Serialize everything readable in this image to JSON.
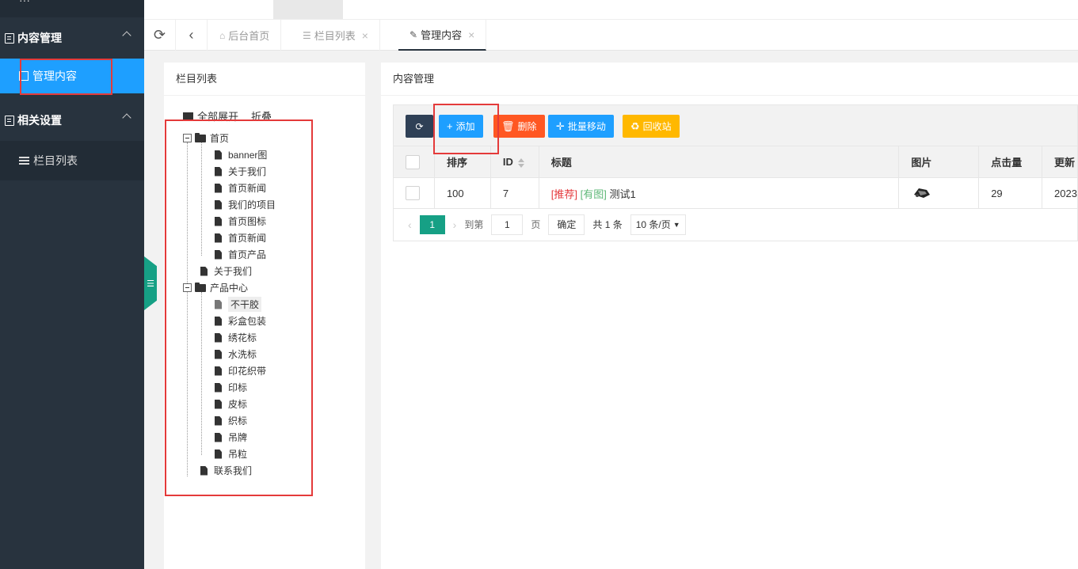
{
  "sidebar": {
    "logo_text": "···",
    "groups": [
      {
        "label": "内容管理",
        "items": [
          {
            "label": "管理内容",
            "active": true
          }
        ]
      },
      {
        "label": "相关设置",
        "items": [
          {
            "label": "栏目列表",
            "active": false
          }
        ]
      }
    ]
  },
  "tabs": [
    {
      "label": "后台首页",
      "icon": "home-icon"
    },
    {
      "label": "栏目列表",
      "icon": "list-icon",
      "closable": true
    },
    {
      "label": "管理内容",
      "icon": "edit-icon",
      "closable": true,
      "active": true
    }
  ],
  "tree_panel": {
    "title": "栏目列表",
    "expand_all": "全部展开",
    "collapse": "折叠",
    "nodes": [
      {
        "label": "首页",
        "children": [
          "banner图",
          "关于我们",
          "首页新闻",
          "我们的项目",
          "首页图标",
          "首页新闻",
          "首页产品"
        ]
      },
      {
        "label": "关于我们"
      },
      {
        "label": "产品中心",
        "children": [
          "不干胶",
          "彩盒包装",
          "绣花标",
          "水洗标",
          "印花织带",
          "印标",
          "皮标",
          "织标",
          "吊牌",
          "吊粒"
        ]
      },
      {
        "label": "联系我们"
      }
    ],
    "selected": "不干胶"
  },
  "content_panel": {
    "title": "内容管理",
    "buttons": {
      "add": "添加",
      "delete": "删除",
      "batch_move": "批量移动",
      "recycle": "回收站"
    },
    "columns": [
      "排序",
      "ID",
      "标题",
      "图片",
      "点击量",
      "更新"
    ],
    "rows": [
      {
        "sort": "100",
        "id": "7",
        "tag1": "[推荐]",
        "tag2": "[有图]",
        "title": "测试1",
        "clicks": "29",
        "updated": "2023"
      }
    ],
    "pager": {
      "current": "1",
      "goto_label": "到第",
      "page_input": "1",
      "page_unit": "页",
      "confirm": "确定",
      "total": "共 1 条",
      "page_size": "10 条/页"
    }
  },
  "colors": {
    "sidebar_bg": "#28333e",
    "active_blue": "#1e9fff",
    "teal": "#16a085",
    "danger": "#ff5722",
    "warm": "#ffb800",
    "highlight_box": "#e43a3a"
  }
}
